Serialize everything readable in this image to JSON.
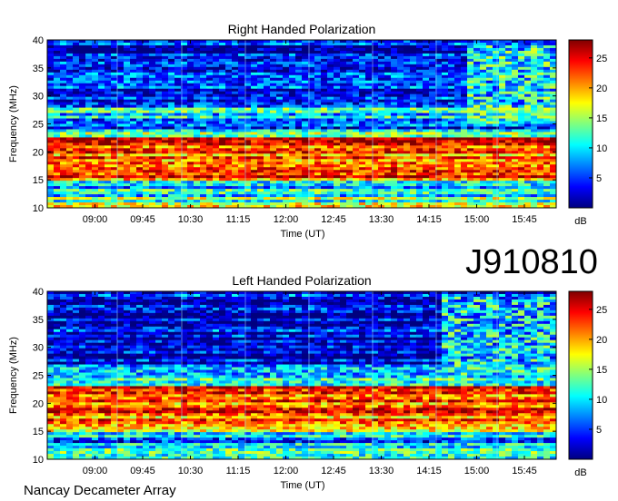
{
  "observation_id": "J910810",
  "footer": "Nancay Decameter Array",
  "colors": {
    "colormap": [
      "#00007f",
      "#0000ff",
      "#007fff",
      "#00ffff",
      "#7fff7f",
      "#ffff00",
      "#ff7f00",
      "#ff0000",
      "#7f0000"
    ]
  },
  "chart_data": [
    {
      "type": "heatmap",
      "title": "Right Handed Polarization",
      "xlabel": "Time (UT)",
      "ylabel": "Frequency (MHz)",
      "x_ticks": [
        "09:00",
        "09:45",
        "10:30",
        "11:15",
        "12:00",
        "12:45",
        "13:30",
        "14:15",
        "15:00",
        "15:45"
      ],
      "y_ticks": [
        10,
        15,
        20,
        25,
        30,
        35,
        40
      ],
      "ylim": [
        10,
        40
      ],
      "xlim": [
        "08:15",
        "16:15"
      ],
      "colorbar": {
        "label": "dB",
        "ticks": [
          5,
          10,
          15,
          20,
          25
        ],
        "range": [
          0,
          28
        ]
      },
      "bands": [
        {
          "freq": [
            10,
            12
          ],
          "level": 14
        },
        {
          "freq": [
            12,
            15
          ],
          "level": 9
        },
        {
          "freq": [
            15,
            16
          ],
          "level": 22
        },
        {
          "freq": [
            16,
            20
          ],
          "level": 21
        },
        {
          "freq": [
            20,
            22.5
          ],
          "level": 24
        },
        {
          "freq": [
            22.5,
            24
          ],
          "level": 12
        },
        {
          "freq": [
            24,
            26
          ],
          "level": 6
        },
        {
          "freq": [
            26,
            28
          ],
          "level": 9
        },
        {
          "freq": [
            28,
            40
          ],
          "level": 3
        }
      ],
      "late_emission": {
        "time": [
          "14:50",
          "16:15"
        ],
        "freq": [
          25,
          39
        ],
        "level": 10
      }
    },
    {
      "type": "heatmap",
      "title": "Left Handed Polarization",
      "xlabel": "Time (UT)",
      "ylabel": "Frequency (MHz)",
      "x_ticks": [
        "09:00",
        "09:45",
        "10:30",
        "11:15",
        "12:00",
        "12:45",
        "13:30",
        "14:15",
        "15:00",
        "15:45"
      ],
      "y_ticks": [
        10,
        15,
        20,
        25,
        30,
        35,
        40
      ],
      "ylim": [
        10,
        40
      ],
      "xlim": [
        "08:15",
        "16:15"
      ],
      "colorbar": {
        "label": "dB",
        "ticks": [
          5,
          10,
          15,
          20,
          25
        ],
        "range": [
          0,
          28
        ]
      },
      "bands": [
        {
          "freq": [
            10,
            12
          ],
          "level": 14
        },
        {
          "freq": [
            12,
            15
          ],
          "level": 8
        },
        {
          "freq": [
            15,
            17
          ],
          "level": 19
        },
        {
          "freq": [
            17,
            20
          ],
          "level": 22
        },
        {
          "freq": [
            20,
            23
          ],
          "level": 23
        },
        {
          "freq": [
            23,
            25
          ],
          "level": 11
        },
        {
          "freq": [
            25,
            27
          ],
          "level": 8
        },
        {
          "freq": [
            27,
            40
          ],
          "level": 3
        }
      ],
      "late_emission": {
        "time": [
          "14:30",
          "16:15"
        ],
        "freq": [
          25,
          39
        ],
        "level": 9
      }
    }
  ]
}
